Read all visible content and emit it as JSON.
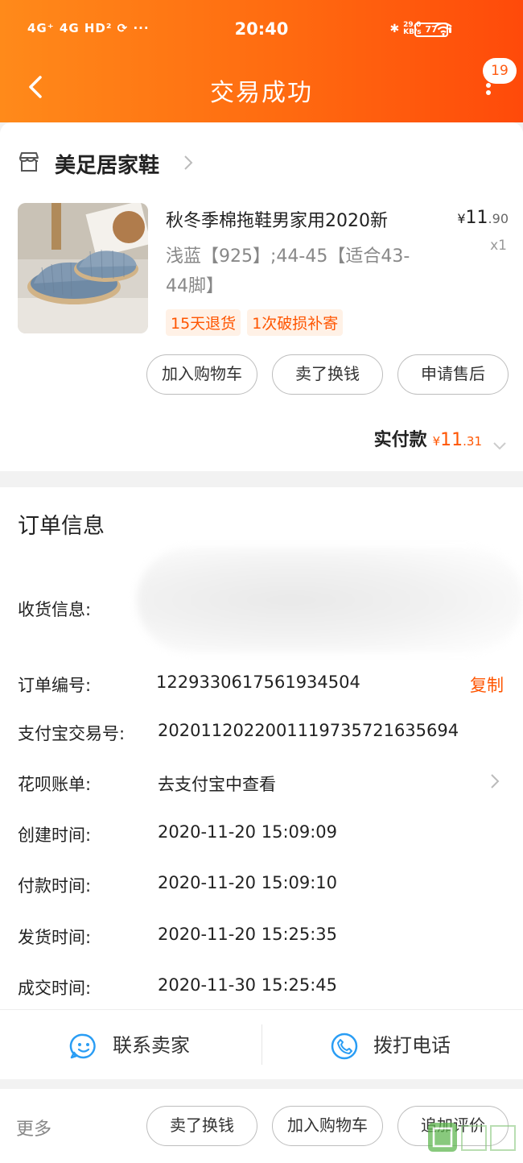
{
  "status_bar": {
    "left_icons": "4G⁺ 4G HD² ⟳ ···",
    "time": "20:40",
    "network_speed": "29.0 KB/s",
    "battery": "77"
  },
  "nav": {
    "title": "交易成功",
    "badge_count": "19"
  },
  "shop": {
    "name": "美足居家鞋"
  },
  "product": {
    "title": "秋冬季棉拖鞋男家用2020新",
    "spec": "浅蓝【925】;44-45【适合43-44脚】",
    "price_currency": "¥",
    "price_main": "11",
    "price_cents": ".90",
    "quantity": "x1",
    "tags": [
      "15天退货",
      "1次破损补寄"
    ]
  },
  "item_actions": [
    "加入购物车",
    "卖了换钱",
    "申请售后"
  ],
  "payment": {
    "label": "实付款",
    "currency": "¥",
    "amount_main": "11",
    "amount_cents": ".31"
  },
  "order_info": {
    "heading": "订单信息",
    "shipping_label": "收货信息:",
    "order_no_label": "订单编号:",
    "order_no": "1229330617561934504",
    "copy_label": "复制",
    "alipay_no_label": "支付宝交易号:",
    "alipay_no": "2020112022001119735721635694",
    "huabei_label": "花呗账单:",
    "huabei_value": "去支付宝中查看",
    "created_label": "创建时间:",
    "created": "2020-11-20 15:09:09",
    "paid_label": "付款时间:",
    "paid": "2020-11-20 15:09:10",
    "shipped_label": "发货时间:",
    "shipped": "2020-11-20 15:25:35",
    "completed_label": "成交时间:",
    "completed": "2020-11-30 15:25:45"
  },
  "contact": {
    "seller": "联系卖家",
    "call": "拨打电话"
  },
  "bottom_bar": {
    "more": "更多",
    "actions": [
      "卖了换钱",
      "加入购物车",
      "追加评价"
    ]
  },
  "colors": {
    "brand_orange": "#ff6a10",
    "accent_text": "#ff5500",
    "icon_blue": "#2a9df4"
  }
}
